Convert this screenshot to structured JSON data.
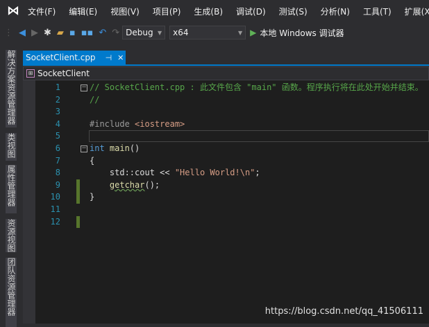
{
  "menubar": {
    "items": [
      "文件(F)",
      "编辑(E)",
      "视图(V)",
      "项目(P)",
      "生成(B)",
      "调试(D)",
      "测试(S)",
      "分析(N)",
      "工具(T)",
      "扩展(X)"
    ]
  },
  "toolbar": {
    "config": "Debug",
    "platform": "x64",
    "run_label": "本地 Windows 调试器"
  },
  "left_tabs": [
    "解决方案资源管理器",
    "类视图",
    "属性管理器",
    "资源视图",
    "团队资源管理器"
  ],
  "tab": {
    "label": "SocketClient.cpp",
    "pin": "⊣",
    "close": "✕"
  },
  "navbar": {
    "scope": "SocketClient"
  },
  "editor": {
    "lines": [
      {
        "n": "1",
        "text": "// SocketClient.cpp : 此文件包含 \"main\" 函数。程序执行将在此处开始并结束。"
      },
      {
        "n": "2",
        "text": "//"
      },
      {
        "n": "3",
        "text": ""
      },
      {
        "n": "4",
        "text": "#include <iostream>"
      },
      {
        "n": "5",
        "text": ""
      },
      {
        "n": "6",
        "text": "int main()"
      },
      {
        "n": "7",
        "text": "{"
      },
      {
        "n": "8",
        "text": "    std::cout << \"Hello World!\\n\";"
      },
      {
        "n": "9",
        "text": "    getchar();"
      },
      {
        "n": "10",
        "text": "}"
      },
      {
        "n": "11",
        "text": ""
      },
      {
        "n": "12",
        "text": ""
      }
    ]
  },
  "watermark": "https://blog.csdn.net/qq_41506111"
}
